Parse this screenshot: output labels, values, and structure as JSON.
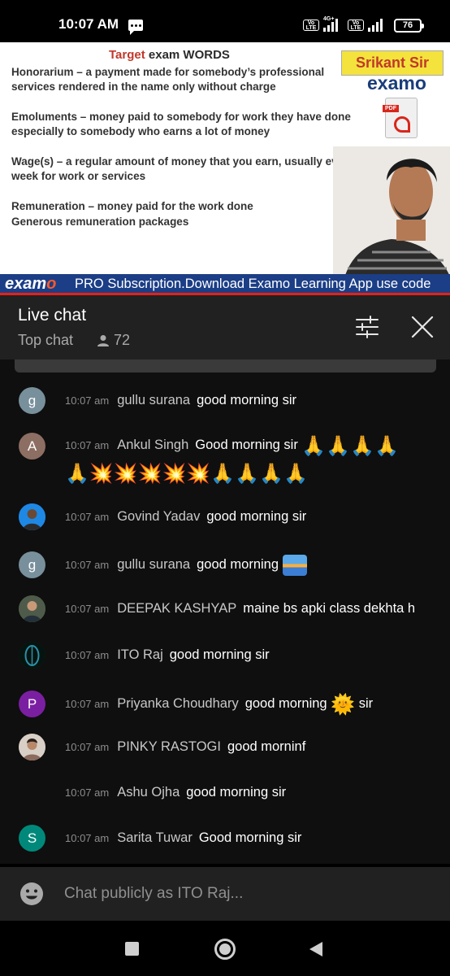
{
  "status_bar": {
    "time": "10:07 AM",
    "sim1_label": "Vo LTE",
    "network_type": "4G+",
    "sim2_label": "Vo LTE",
    "battery": "76"
  },
  "video": {
    "slide_title_accent": "Target",
    "slide_title_rest": " exam WORDS",
    "slide_lines": [
      "Honorarium – a payment made for somebody’s professional",
      "services rendered in the name only without charge",
      "Emoluments – money paid to somebody for work they have done",
      "especially to somebody who earns a lot of money",
      "Wage(s) – a regular amount of money that you earn, usually every",
      "week for work or services",
      "Remuneration – money paid for the work done",
      "Generous remuneration packages"
    ],
    "presenter_badge": "Srikant Sir",
    "brand": "examo",
    "pdf_label": "PDF",
    "ticker_brand": "exam",
    "ticker_text": "PRO Subscription.Download Examo Learning App use code"
  },
  "chat_header": {
    "title": "Live chat",
    "mode": "Top chat",
    "viewer_count": "72"
  },
  "messages": [
    {
      "avatar_letter": "g",
      "avatar_color": "#78909c",
      "time": "10:07 am",
      "author": "gullu surana",
      "text": "good morning sir"
    },
    {
      "avatar_letter": "A",
      "avatar_color": "#8d6e63",
      "time": "10:07 am",
      "author": "Ankul Singh",
      "text": "Good morning sir",
      "emoji_line1": "🙏🙏🙏🙏",
      "emoji_line2_pray_a": "🙏",
      "emoji_line2_burst": "💥💥💥💥💥",
      "emoji_line2_pray_b": "🙏🙏🙏🙏"
    },
    {
      "avatar_letter": "",
      "avatar_color": "#1e88e5",
      "time": "10:07 am",
      "author": "Govind Yadav",
      "text": "good morning sir"
    },
    {
      "avatar_letter": "g",
      "avatar_color": "#78909c",
      "time": "10:07 am",
      "author": "gullu surana",
      "text": "good morning"
    },
    {
      "avatar_letter": "",
      "avatar_color": "#4e5b4a",
      "time": "10:07 am",
      "author": "DEEPAK KASHYAP",
      "text": "maine bs apki class dekhta h"
    },
    {
      "avatar_letter": "",
      "avatar_color": "#0f3b33",
      "time": "10:07 am",
      "author": "ITO Raj",
      "text": "good morning sir"
    },
    {
      "avatar_letter": "P",
      "avatar_color": "#7b1fa2",
      "time": "10:07 am",
      "author": "Priyanka Choudhary",
      "text": "good morning",
      "emoji": "🌞",
      "text_after": "sir"
    },
    {
      "avatar_letter": "",
      "avatar_color": "#a1887f",
      "time": "10:07 am",
      "author": "PINKY RASTOGI",
      "text": "good morninf"
    },
    {
      "avatar_letter": "",
      "avatar_color": "",
      "time": "10:07 am",
      "author": "Ashu Ojha",
      "text": "good morning sir"
    },
    {
      "avatar_letter": "S",
      "avatar_color": "#00897b",
      "time": "10:07 am",
      "author": "Sarita Tuwar",
      "text": "Good morning sir"
    }
  ],
  "input": {
    "placeholder": "Chat publicly as ITO Raj..."
  },
  "icons": {
    "filter": "tune-sliders-icon",
    "close": "close-icon",
    "emoji": "smiley-icon",
    "viewers": "person-icon",
    "nav_recents": "square-icon",
    "nav_home": "circle-icon",
    "nav_back": "triangle-back-icon"
  }
}
